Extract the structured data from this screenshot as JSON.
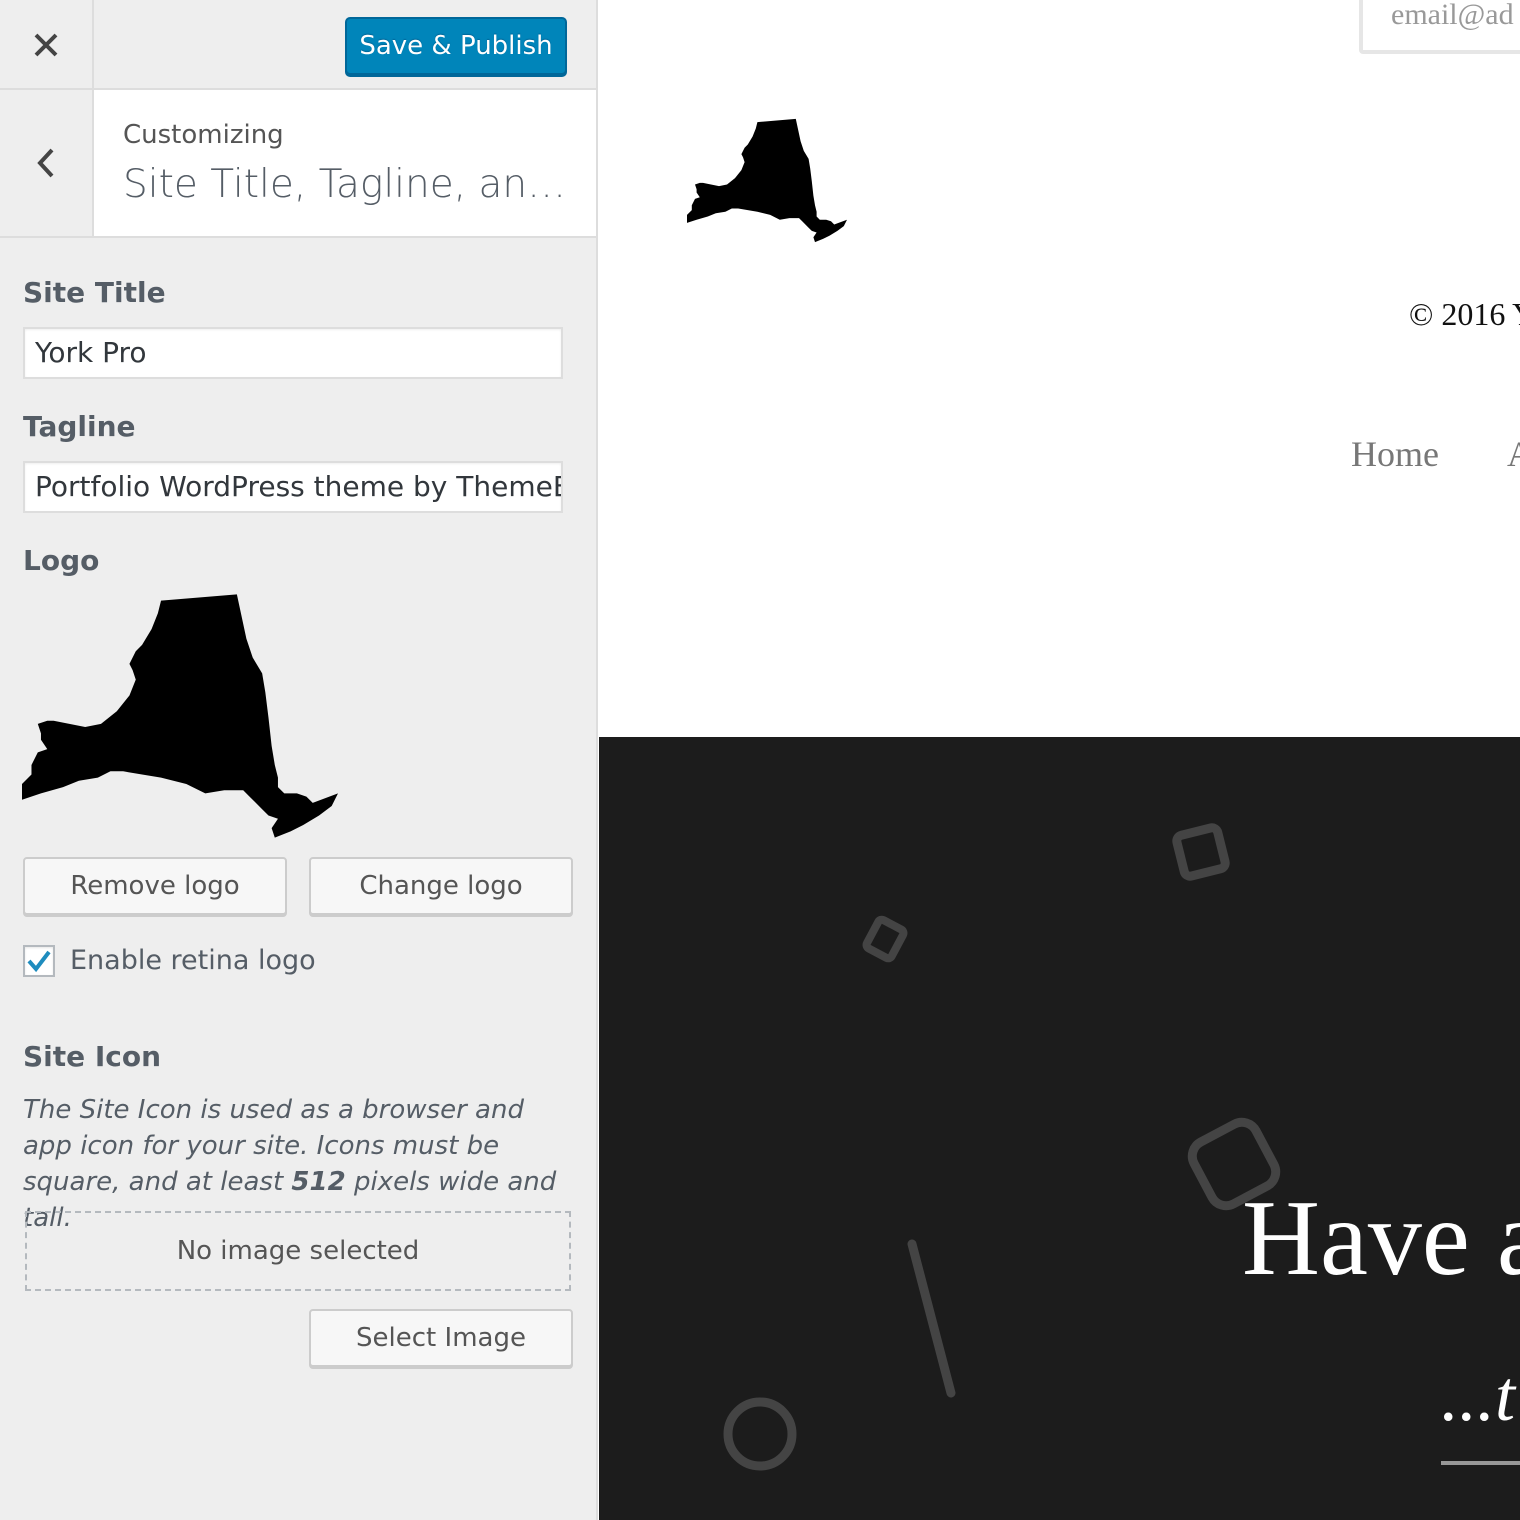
{
  "toolbar": {
    "save_publish_label": "Save & Publish"
  },
  "section": {
    "customizing_label": "Customizing",
    "title": "Site Title, Tagline, and Logo"
  },
  "fields": {
    "site_title_label": "Site Title",
    "site_title_value": "York Pro",
    "tagline_label": "Tagline",
    "tagline_value": "Portfolio WordPress theme by ThemeBeans",
    "logo_label": "Logo",
    "remove_logo_label": "Remove logo",
    "change_logo_label": "Change logo",
    "retina_label": "Enable retina logo",
    "retina_checked": true,
    "site_icon_label": "Site Icon",
    "site_icon_desc_pre": "The Site Icon is used as a browser and app icon for your site. Icons must be square, and at least ",
    "site_icon_desc_bold": "512",
    "site_icon_desc_post": " pixels wide and tall.",
    "no_image_label": "No image selected",
    "select_image_label": "Select Image"
  },
  "preview": {
    "email_placeholder": "email@ad",
    "copyright": "© 2016 Y",
    "nav_home": "Home",
    "nav_next": "A",
    "hero_heading": "Have a",
    "hero_sub": "...t"
  },
  "colors": {
    "primary_button": "#0085ba",
    "sidebar_bg": "#eeeeee",
    "hero_bg": "#1c1c1c",
    "checkbox_check": "#1e8cbe"
  },
  "icons": {
    "close": "close-icon",
    "back": "chevron-left-icon",
    "check": "checkmark-icon",
    "logo": "new-york-state-silhouette"
  }
}
